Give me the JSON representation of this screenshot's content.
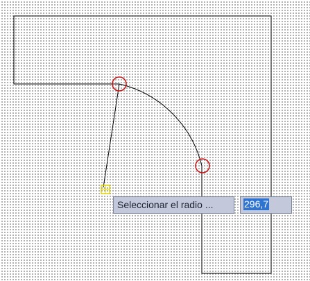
{
  "drawing_area": {
    "grid_dot_color": "#4a4a4a",
    "line_color": "#000000",
    "grip_marker_color": "#cc1111",
    "snap_marker_color": "#e0d400"
  },
  "command_prompt": {
    "text": "Seleccionar el radio ..."
  },
  "dynamic_input": {
    "value": "296,7",
    "highlight_color": "#3074d2"
  }
}
